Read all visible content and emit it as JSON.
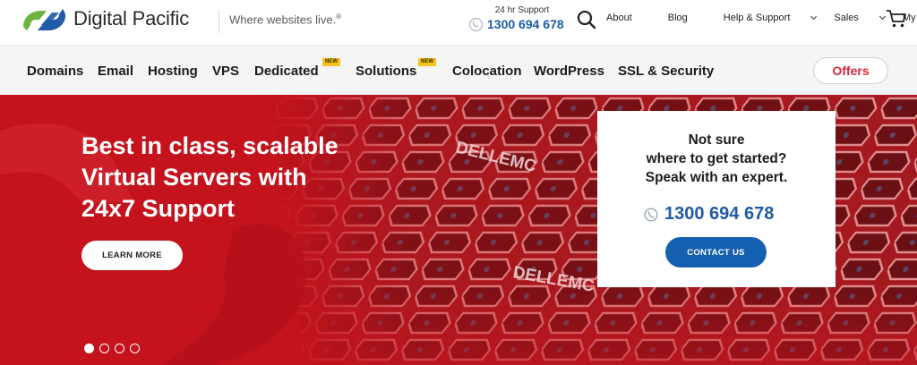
{
  "brand": {
    "name": "Digital Pacific",
    "tagline": "Where websites live.",
    "tagline_mark": "®",
    "colors": {
      "blue": "#1e5ba8",
      "green": "#6cb33f",
      "red": "#c4131d",
      "accent_pink": "#d7263d"
    }
  },
  "support": {
    "label": "24 hr Support",
    "number": "1300 694 678"
  },
  "top_links": [
    {
      "label": "About",
      "dropdown": false
    },
    {
      "label": "Blog",
      "dropdown": false
    },
    {
      "label": "Help & Support",
      "dropdown": true
    },
    {
      "label": "Sales",
      "dropdown": true
    },
    {
      "label": "My Account",
      "dropdown": true
    }
  ],
  "icons": {
    "search": "search-icon",
    "cart": "cart-icon",
    "phone": "phone-icon"
  },
  "nav": {
    "items": [
      {
        "label": "Domains"
      },
      {
        "label": "Email"
      },
      {
        "label": "Hosting"
      },
      {
        "label": "VPS"
      },
      {
        "label": "Dedicated",
        "badge": "NEW"
      },
      {
        "label": "Solutions",
        "badge": "NEW"
      },
      {
        "label": "Colocation"
      },
      {
        "label": "WordPress"
      },
      {
        "label": "SSL & Security"
      }
    ],
    "offers": "Offers"
  },
  "hero": {
    "title_lines": [
      "Best in class, scalable",
      "Virtual Servers with",
      "24x7 Support"
    ],
    "cta": "LEARN MORE",
    "slides": 4,
    "active_slide": 1,
    "server_brand_text": "DELLEMC"
  },
  "cta_card": {
    "heading_lines": [
      "Not sure",
      "where to get started?",
      "Speak with an expert."
    ],
    "phone": "1300 694 678",
    "button": "CONTACT US"
  }
}
